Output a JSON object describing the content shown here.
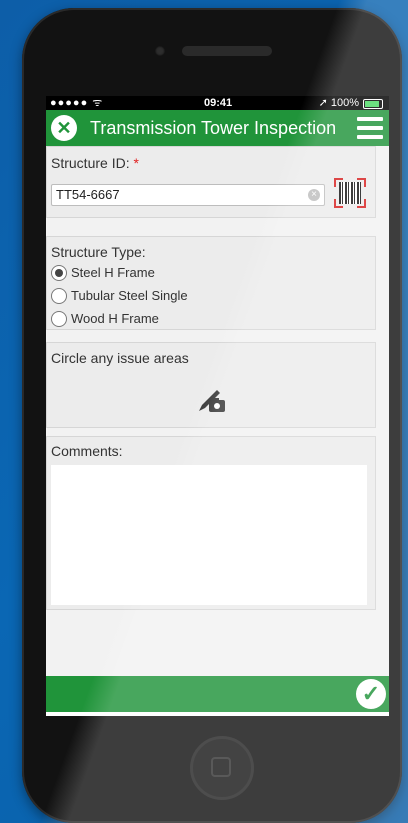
{
  "status_bar": {
    "signal": "●●●●● ᯤ",
    "time": "09:41",
    "battery": "➚ 100%"
  },
  "header": {
    "title": "Transmission Tower Inspection"
  },
  "form": {
    "structure_id": {
      "label": "Structure ID:",
      "required_mark": "*",
      "value": "TT54-6667"
    },
    "structure_type": {
      "label": "Structure Type:",
      "options": [
        {
          "label": "Steel H Frame",
          "selected": true
        },
        {
          "label": "Tubular Steel Single",
          "selected": false
        },
        {
          "label": "Wood H Frame",
          "selected": false
        }
      ]
    },
    "sketch": {
      "label": "Circle any issue areas"
    },
    "comments": {
      "label": "Comments:"
    }
  },
  "colors": {
    "accent": "#20943a",
    "required": "#e02020",
    "barcode_frame": "#d61f1f"
  },
  "icons": {
    "close": "close-icon",
    "menu": "hamburger-menu-icon",
    "barcode": "barcode-scan-icon",
    "sketch": "pencil-camera-icon",
    "submit": "checkmark-icon"
  }
}
